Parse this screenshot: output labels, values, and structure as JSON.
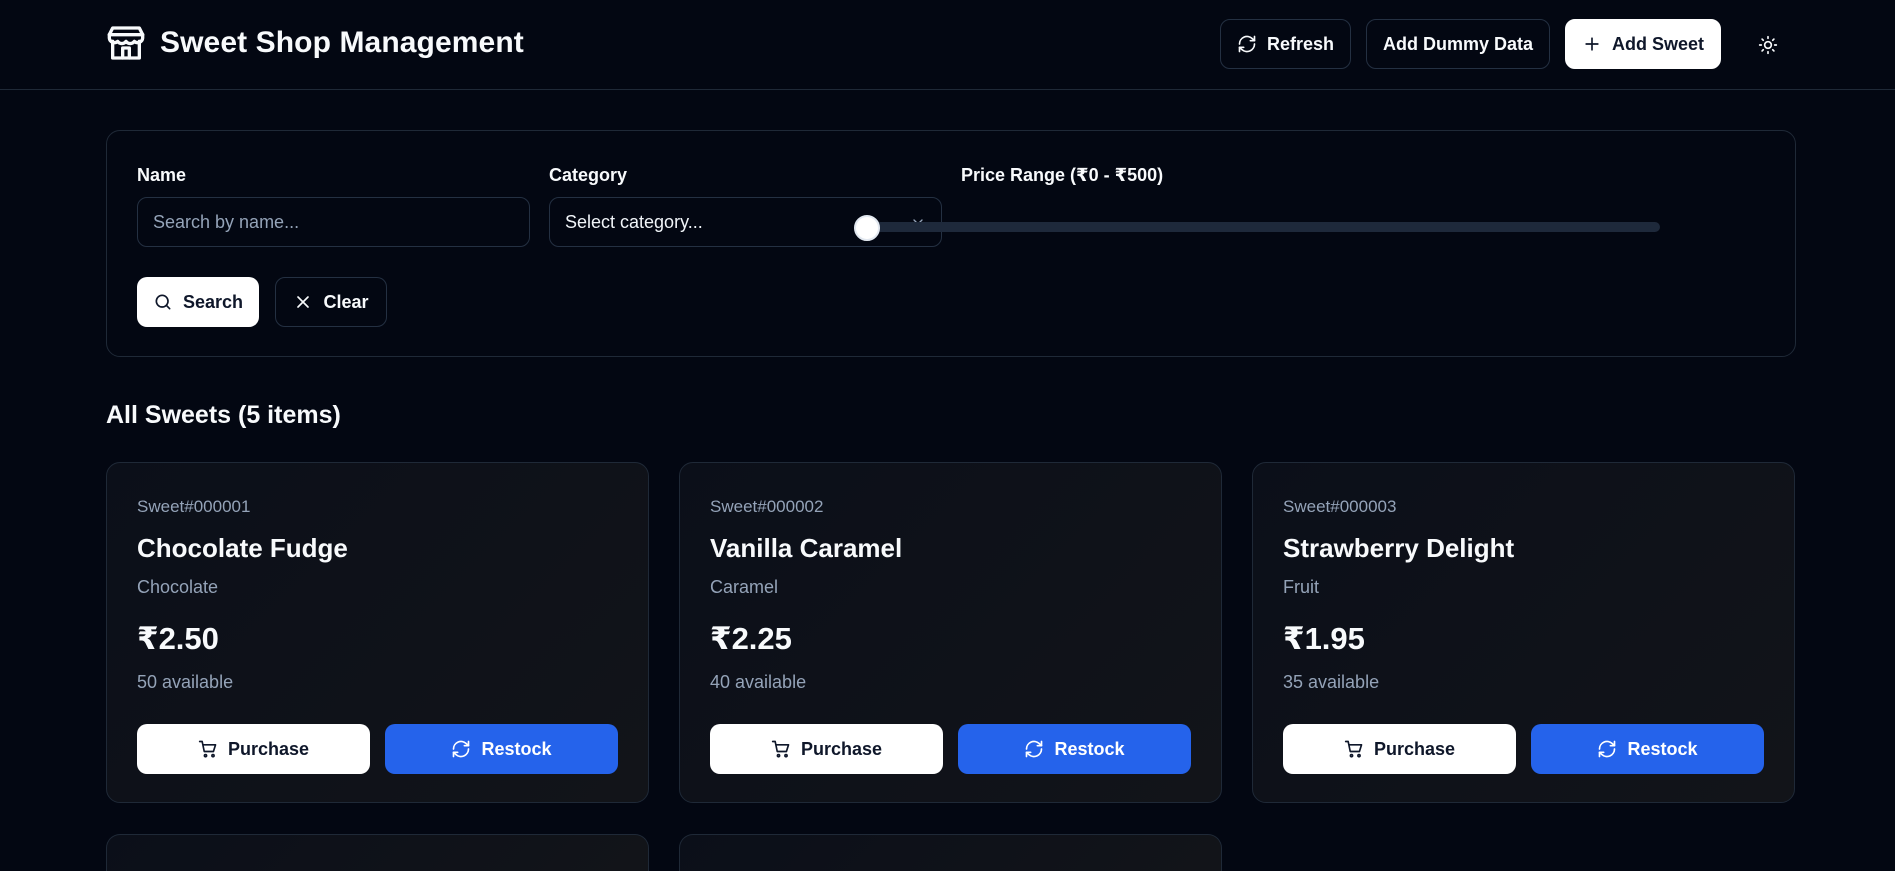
{
  "header": {
    "title": "Sweet Shop Management",
    "refresh_label": "Refresh",
    "dummy_label": "Add Dummy Data",
    "add_label": "Add Sweet"
  },
  "filters": {
    "name_label": "Name",
    "name_placeholder": "Search by name...",
    "category_label": "Category",
    "category_value": "Select category...",
    "price_label": "Price Range (₹0 - ₹500)",
    "price_min": 0,
    "price_max": 500,
    "slider_value": 0,
    "search_label": "Search",
    "clear_label": "Clear"
  },
  "list": {
    "title": "All Sweets (5 items)"
  },
  "sweets": [
    {
      "id": "Sweet#000001",
      "name": "Chocolate Fudge",
      "category": "Chocolate",
      "price": "₹2.50",
      "stock": "50 available",
      "purchase": "Purchase",
      "restock": "Restock"
    },
    {
      "id": "Sweet#000002",
      "name": "Vanilla Caramel",
      "category": "Caramel",
      "price": "₹2.25",
      "stock": "40 available",
      "purchase": "Purchase",
      "restock": "Restock"
    },
    {
      "id": "Sweet#000003",
      "name": "Strawberry Delight",
      "category": "Fruit",
      "price": "₹1.95",
      "stock": "35 available",
      "purchase": "Purchase",
      "restock": "Restock"
    }
  ],
  "colors": {
    "background": "#030712",
    "border": "#1f2937",
    "primary_blue": "#2563eb",
    "muted_text": "#94a3b8"
  }
}
